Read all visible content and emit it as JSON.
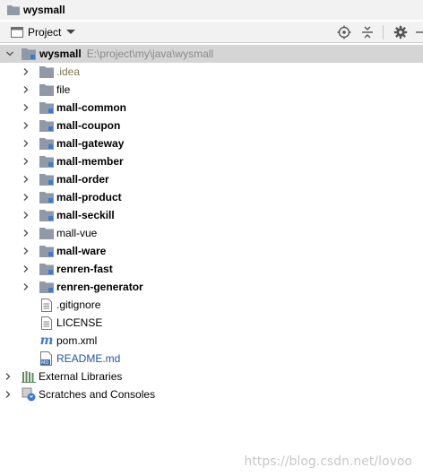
{
  "title": "wysmall",
  "toolbar": {
    "view_label": "Project",
    "icons": [
      "locate-icon",
      "collapse-icon",
      "settings-icon"
    ]
  },
  "tree": {
    "root": {
      "name": "wysmall",
      "path": "E:\\project\\my\\java\\wysmall"
    },
    "items": [
      {
        "label": ".idea"
      },
      {
        "label": "file"
      },
      {
        "label": "mall-common"
      },
      {
        "label": "mall-coupon"
      },
      {
        "label": "mall-gateway"
      },
      {
        "label": "mall-member"
      },
      {
        "label": "mall-order"
      },
      {
        "label": "mall-product"
      },
      {
        "label": "mall-seckill"
      },
      {
        "label": "mall-vue"
      },
      {
        "label": "mall-ware"
      },
      {
        "label": "renren-fast"
      },
      {
        "label": "renren-generator"
      },
      {
        "label": ".gitignore"
      },
      {
        "label": "LICENSE"
      },
      {
        "label": "pom.xml"
      },
      {
        "label": "README.md"
      }
    ],
    "external_libraries": "External Libraries",
    "scratches": "Scratches and Consoles"
  },
  "watermark": "https://blog.csdn.net/lovoo"
}
